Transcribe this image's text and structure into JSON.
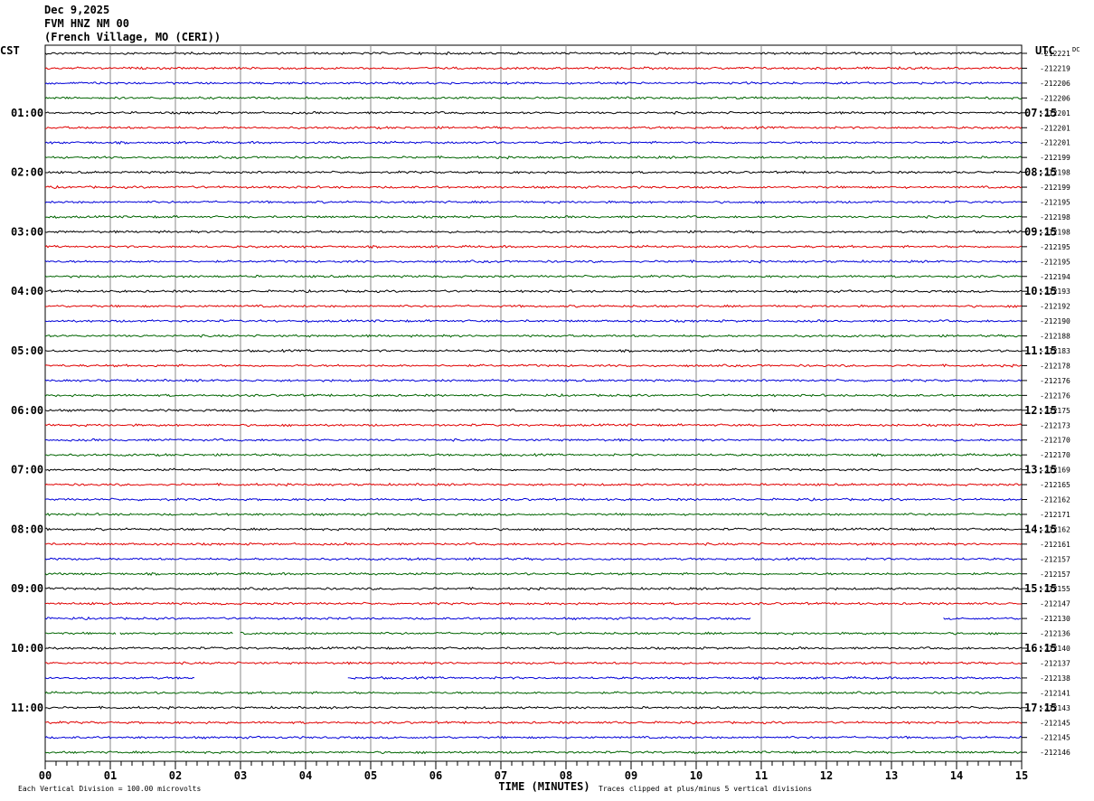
{
  "header": {
    "date": "Dec 9,2025",
    "station": "FVM HNZ NM 00",
    "location": "(French Village, MO (CERI))"
  },
  "chart_data": {
    "type": "line",
    "title": "FVM HNZ NM 00",
    "left_axis_label": "CST",
    "right_axis_label": "UTC",
    "dc_label": "DC",
    "xlabel": "TIME (MINUTES)",
    "x_ticks": [
      "00",
      "01",
      "02",
      "03",
      "04",
      "05",
      "06",
      "07",
      "08",
      "09",
      "10",
      "11",
      "12",
      "13",
      "14",
      "15"
    ],
    "xlim": [
      0,
      15
    ],
    "left_hour_labels": [
      "01:00",
      "02:00",
      "03:00",
      "04:00",
      "05:00",
      "06:00",
      "07:00",
      "08:00",
      "09:00",
      "10:00",
      "11:00"
    ],
    "right_hour_labels": [
      "07:15",
      "08:15",
      "09:15",
      "10:15",
      "11:15",
      "12:15",
      "13:15",
      "14:15",
      "15:15",
      "16:15",
      "17:15"
    ],
    "trace_colors": [
      "#000000",
      "#e00000",
      "#0000d8",
      "#006400"
    ],
    "dc_offsets": [
      212221,
      212219,
      212206,
      212206,
      212201,
      212201,
      212201,
      212199,
      212198,
      212199,
      212195,
      212198,
      212198,
      212195,
      212195,
      212194,
      212193,
      212192,
      212190,
      212188,
      212183,
      212178,
      212176,
      212176,
      212175,
      212173,
      212170,
      212170,
      212169,
      212165,
      212162,
      212171,
      212162,
      212161,
      212157,
      212157,
      212155,
      212147,
      212130,
      212136,
      212140,
      212137,
      212138,
      212141,
      212143,
      212145,
      212145,
      212146
    ],
    "gaps": [
      {
        "trace": 38,
        "from": 10.85,
        "to": 13.8
      },
      {
        "trace": 39,
        "from": 1.1,
        "to": 1.15
      },
      {
        "trace": 39,
        "from": 2.9,
        "to": 3.0
      },
      {
        "trace": 42,
        "from": 2.3,
        "to": 4.65
      }
    ],
    "footer_left": "Each Vertical Division =  100.00 microvolts",
    "footer_right": "Traces clipped at plus/minus 5 vertical divisions"
  }
}
